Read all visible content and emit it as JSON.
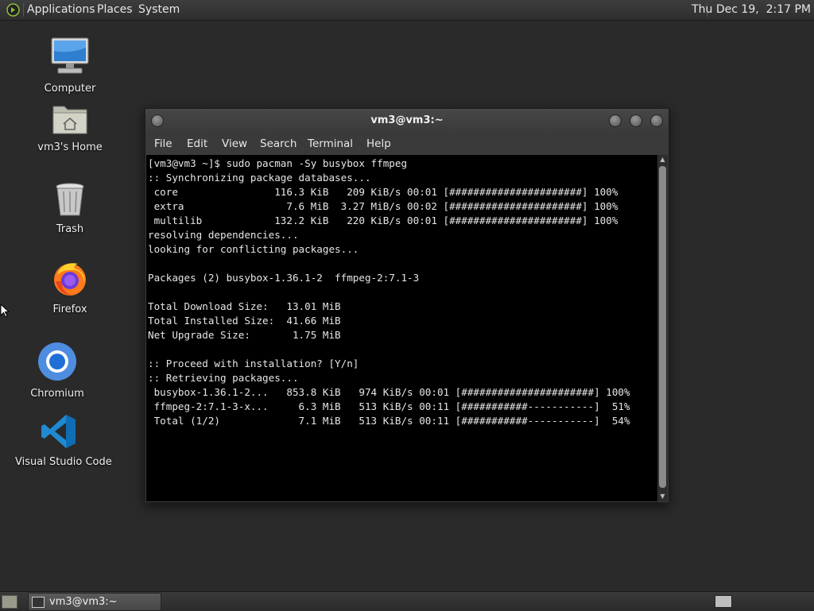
{
  "top_panel": {
    "menus": [
      "Applications",
      "Places",
      "System"
    ],
    "clock": "Thu Dec 19,  2:17 PM"
  },
  "desktop": {
    "icons": [
      {
        "label": "Computer",
        "icon": "computer-icon"
      },
      {
        "label": "vm3's Home",
        "icon": "home-folder-icon"
      },
      {
        "label": "Trash",
        "icon": "trash-icon"
      },
      {
        "label": "Firefox",
        "icon": "firefox-icon"
      },
      {
        "label": "Chromium",
        "icon": "chromium-icon"
      },
      {
        "label": "Visual Studio Code",
        "icon": "vscode-icon"
      }
    ]
  },
  "terminal": {
    "title": "vm3@vm3:~",
    "menu": [
      "File",
      "Edit",
      "View",
      "Search",
      "Terminal",
      "Help"
    ],
    "lines": [
      "[vm3@vm3 ~]$ sudo pacman -Sy busybox ffmpeg",
      ":: Synchronizing package databases...",
      " core                116.3 KiB   209 KiB/s 00:01 [######################] 100%",
      " extra                 7.6 MiB  3.27 MiB/s 00:02 [######################] 100%",
      " multilib            132.2 KiB   220 KiB/s 00:01 [######################] 100%",
      "resolving dependencies...",
      "looking for conflicting packages...",
      "",
      "Packages (2) busybox-1.36.1-2  ffmpeg-2:7.1-3",
      "",
      "Total Download Size:   13.01 MiB",
      "Total Installed Size:  41.66 MiB",
      "Net Upgrade Size:       1.75 MiB",
      "",
      ":: Proceed with installation? [Y/n]",
      ":: Retrieving packages...",
      " busybox-1.36.1-2...   853.8 KiB   974 KiB/s 00:01 [######################] 100%",
      " ffmpeg-2:7.1-3-x...     6.3 MiB   513 KiB/s 00:11 [###########-----------]  51%",
      " Total (1/2)             7.1 MiB   513 KiB/s 00:11 [###########-----------]  54%"
    ]
  },
  "taskbar": {
    "tasks": [
      {
        "label": "vm3@vm3:~",
        "icon": "terminal-icon"
      }
    ]
  }
}
